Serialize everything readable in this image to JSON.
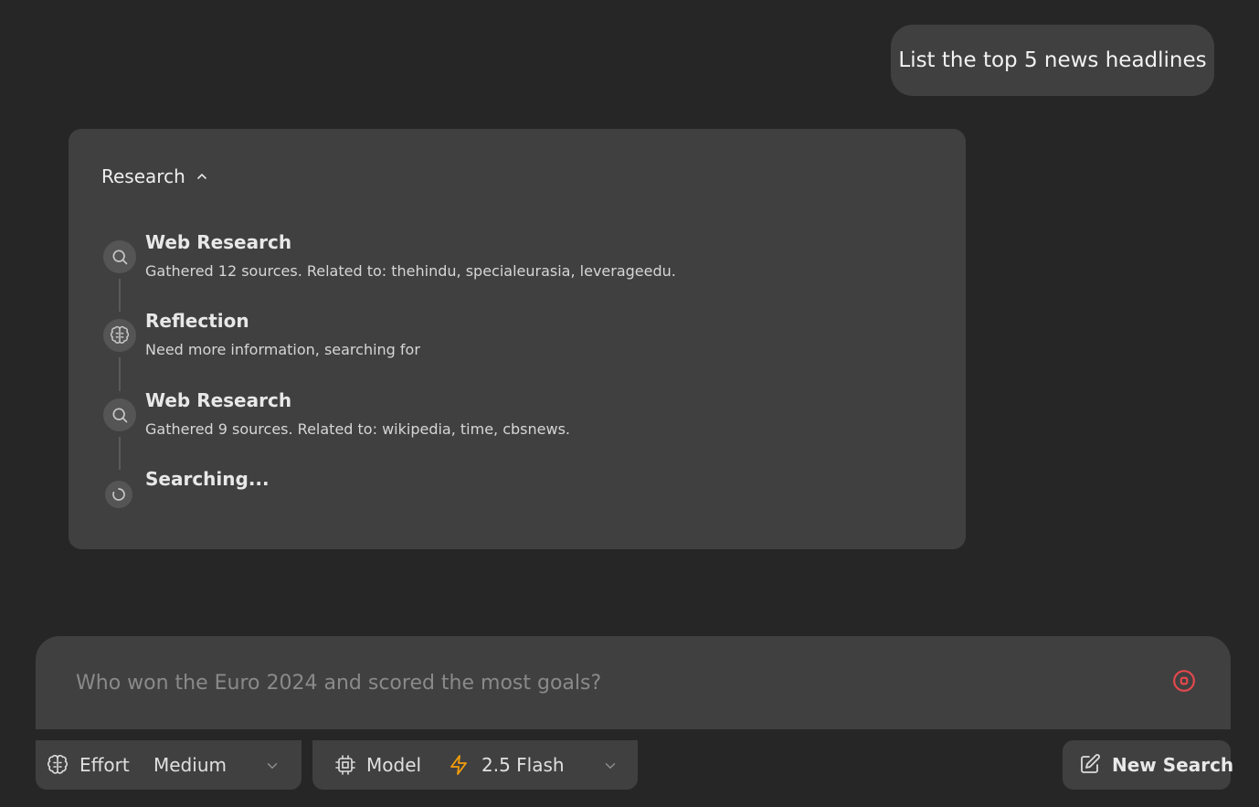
{
  "conversation": {
    "user_message": "List the top 5 news headlines"
  },
  "research": {
    "header_label": "Research",
    "items": [
      {
        "title": "Web Research",
        "description": "Gathered 12 sources. Related to: thehindu, specialeurasia, leverageedu.",
        "icon": "search-icon"
      },
      {
        "title": "Reflection",
        "description": "Need more information, searching for",
        "icon": "brain-icon"
      },
      {
        "title": "Web Research",
        "description": "Gathered 9 sources. Related to: wikipedia, time, cbsnews.",
        "icon": "search-icon"
      },
      {
        "title": "Searching...",
        "description": "",
        "icon": "loader-icon"
      }
    ]
  },
  "composer": {
    "placeholder": "Who won the Euro 2024 and scored the most goals?",
    "value": ""
  },
  "controls": {
    "effort": {
      "label": "Effort",
      "value": "Medium",
      "icon": "brain-icon"
    },
    "model": {
      "label": "Model",
      "value": "2.5 Flash",
      "icon": "cpu-icon",
      "value_icon": "lightning-icon"
    },
    "new_search": {
      "label": "New Search",
      "icon": "edit-icon"
    }
  },
  "colors": {
    "background": "#262626",
    "surface": "#404040",
    "accent_stop": "#e5484d",
    "flash_icon": "#f59e0b"
  }
}
